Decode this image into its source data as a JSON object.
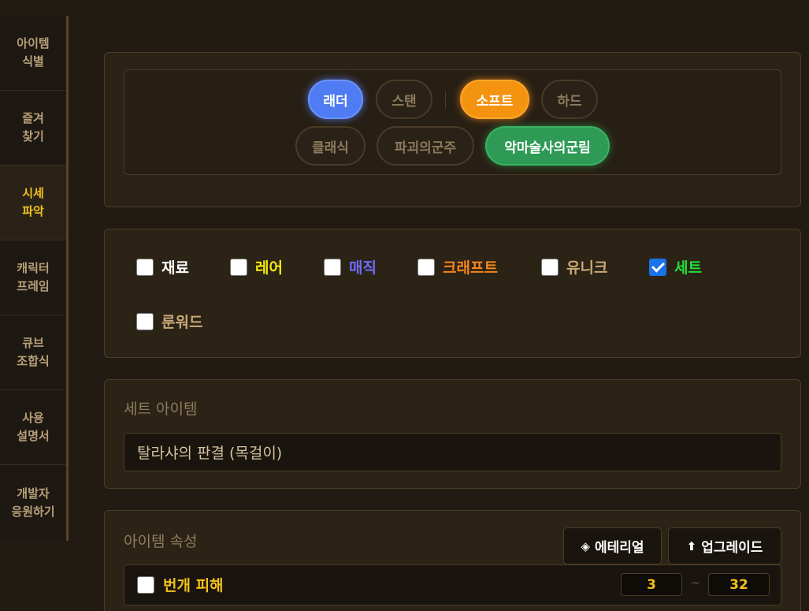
{
  "sidebar": {
    "items": [
      {
        "label": "아이템\n식별"
      },
      {
        "label": "즐겨\n찾기"
      },
      {
        "label": "시세\n파악"
      },
      {
        "label": "캐릭터\n프레임"
      },
      {
        "label": "큐브\n조합식"
      },
      {
        "label": "사용\n설명서"
      },
      {
        "label": "개발자\n응원하기"
      }
    ],
    "active_index": 2
  },
  "modes": {
    "row1": [
      "래더",
      "스탠",
      "소프트",
      "하드"
    ],
    "row2": [
      "클래식",
      "파괴의군주",
      "악마술사의군림"
    ],
    "selected": [
      "래더",
      "소프트",
      "악마술사의군림"
    ]
  },
  "rarity": {
    "items": [
      {
        "label": "재료",
        "color": "#ffffff",
        "checked": false
      },
      {
        "label": "레어",
        "color": "#f5e90f",
        "checked": false
      },
      {
        "label": "매직",
        "color": "#6f6bff",
        "checked": false
      },
      {
        "label": "크래프트",
        "color": "#f7861c",
        "checked": false
      },
      {
        "label": "유니크",
        "color": "#c9a977",
        "checked": false
      },
      {
        "label": "세트",
        "color": "#22e03a",
        "checked": true
      },
      {
        "label": "룬워드",
        "color": "#c9a977",
        "checked": false
      }
    ]
  },
  "set_item": {
    "title": "세트 아이템",
    "value": "탈라샤의 판결 (목걸이)"
  },
  "attributes": {
    "title": "아이템 속성",
    "ethereal_label": "에테리얼",
    "ethereal_icon": "diamond-icon",
    "upgrade_label": "업그레이드",
    "upgrade_icon": "arrow-up-icon",
    "rows": [
      {
        "label": "번개 피해",
        "min": "3",
        "max": "32",
        "separator": "~",
        "checked": false
      }
    ]
  },
  "colors": {
    "accent_gold": "#f2c21b",
    "ladder_blue": "#4f7cf2",
    "soft_orange": "#f4930f",
    "expansion_green": "#2e9a55"
  }
}
